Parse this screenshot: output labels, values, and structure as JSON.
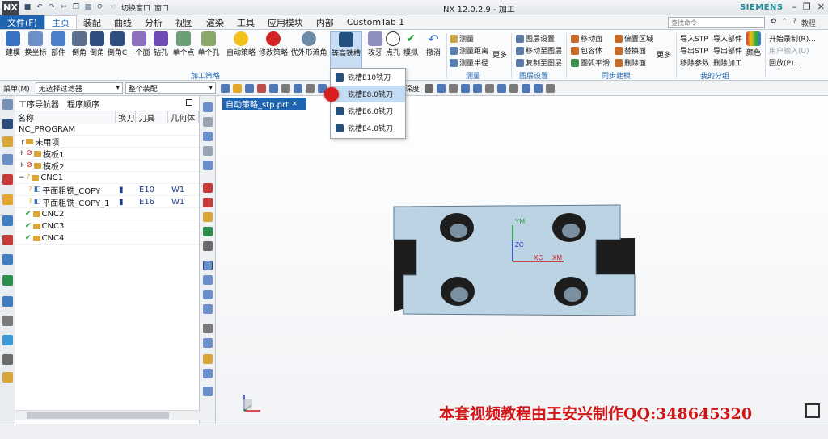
{
  "titlebar": {
    "app_title": "NX 12.0.2.9 - 加工",
    "brand": "SIEMENS",
    "quick_access": {
      "switch_window": "切换窗口",
      "window": "窗口"
    }
  },
  "menubar": {
    "file_label": "文件(F)",
    "tabs": [
      "主页",
      "装配",
      "曲线",
      "分析",
      "视图",
      "渲染",
      "工具",
      "应用模块",
      "内部",
      "CustomTab 1"
    ],
    "active_tab": "主页",
    "command_search_placeholder": "查找命令",
    "tutorial_label": "教程"
  },
  "ribbon": {
    "buttons": [
      "建模",
      "换坐标",
      "部件",
      "倒角",
      "倒角",
      "倒角C",
      "一个面",
      "钻孔",
      "单个点",
      "单个孔",
      "自动策略",
      "修改策略",
      "优外形流角",
      "等高铣槽",
      "攻牙",
      "点孔",
      "模拟",
      "撤消"
    ],
    "group_processing": "加工策略",
    "measure": {
      "items": [
        "测量",
        "测量距离",
        "测量半径"
      ],
      "more": "更多",
      "group": "测量"
    },
    "layer": {
      "items": [
        "图层设置",
        "移动至图层",
        "复制至图层"
      ],
      "group": "图层设置"
    },
    "sync": {
      "col1": [
        "移动面",
        "包容体",
        "圆弧平滑"
      ],
      "col2": [
        "偏置区域",
        "替换面",
        "删除面"
      ],
      "more": "更多",
      "group": "同步建模"
    },
    "mine": {
      "col1": [
        "导入STP",
        "导出STP",
        "移除参数"
      ],
      "col2": [
        "导入部件",
        "导出部件",
        "删除加工"
      ],
      "color": "颜色",
      "group": "我的分组"
    },
    "macro": {
      "items": [
        "开始录制(R)...",
        "用户输入(U)",
        "回放(P)..."
      ]
    }
  },
  "toolbar2": {
    "menu_label": "菜单(M)",
    "filter_value": "无选择过滤器",
    "assembly_value": "整个装配",
    "tip_depth_label": "刀尖深度"
  },
  "navigator": {
    "tabs": [
      "工序导航器",
      "程序顺序"
    ],
    "columns": [
      "名称",
      "换刀",
      "刀具",
      "几何体"
    ],
    "rows": [
      {
        "name": "NC_PROGRAM",
        "tool": "",
        "geom": ""
      },
      {
        "name": "未用项",
        "tool": "",
        "geom": ""
      },
      {
        "name": "模板1",
        "tool": "",
        "geom": ""
      },
      {
        "name": "模板2",
        "tool": "",
        "geom": ""
      },
      {
        "name": "CNC1",
        "tool": "",
        "geom": ""
      },
      {
        "name": "平面粗铣_COPY",
        "tool": "E10",
        "geom": "W1"
      },
      {
        "name": "平面粗铣_COPY_1",
        "tool": "E16",
        "geom": "W1"
      },
      {
        "name": "CNC2",
        "tool": "",
        "geom": ""
      },
      {
        "name": "CNC3",
        "tool": "",
        "geom": ""
      },
      {
        "name": "CNC4",
        "tool": "",
        "geom": ""
      }
    ]
  },
  "graphics": {
    "file_tab": "自动策略_stp.prt",
    "axis_labels": {
      "ym": "YM",
      "zc": "ZC",
      "xc": "XC",
      "xm": "XM"
    }
  },
  "dropdown": {
    "items": [
      "铣槽E10铣刀",
      "铣槽E8.0铣刀",
      "铣槽E6.0铣刀",
      "铣槽E4.0铣刀"
    ],
    "hovered_index": 1
  },
  "watermark": "本套视频教程由王安兴制作QQ:348645320",
  "colors": {
    "accent": "#1e64b0",
    "part_face": "#bcd3e4",
    "watermark": "#d01616",
    "success": "#1a9b2f"
  }
}
